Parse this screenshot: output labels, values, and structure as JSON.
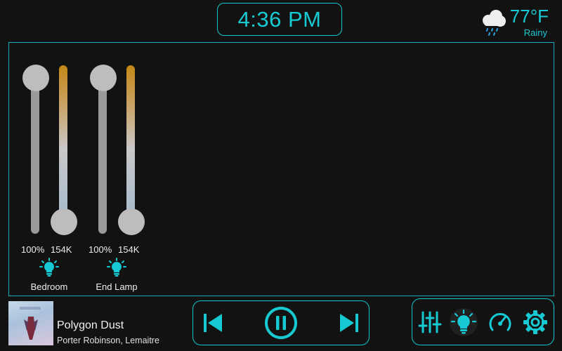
{
  "header": {
    "time": "4:36 PM"
  },
  "weather": {
    "temperature": "77°F",
    "condition": "Rainy",
    "icon": "cloud-rain-icon"
  },
  "lights": [
    {
      "name": "Bedroom",
      "brightness": "100%",
      "color_temp": "154K",
      "brightness_level": 1.0,
      "temp_level": 0.0
    },
    {
      "name": "End Lamp",
      "brightness": "100%",
      "color_temp": "154K",
      "brightness_level": 1.0,
      "temp_level": 0.0
    }
  ],
  "now_playing": {
    "title": "Polygon Dust",
    "artist": "Porter Robinson, Lemaitre"
  },
  "colors": {
    "accent": "#17c9d2",
    "background": "#121212",
    "knob": "#bdbdbd"
  },
  "media_controls": [
    "previous-icon",
    "pause-icon",
    "next-icon"
  ],
  "nav_icons": [
    "sliders-icon",
    "lightbulb-icon",
    "gauge-icon",
    "settings-icon"
  ]
}
